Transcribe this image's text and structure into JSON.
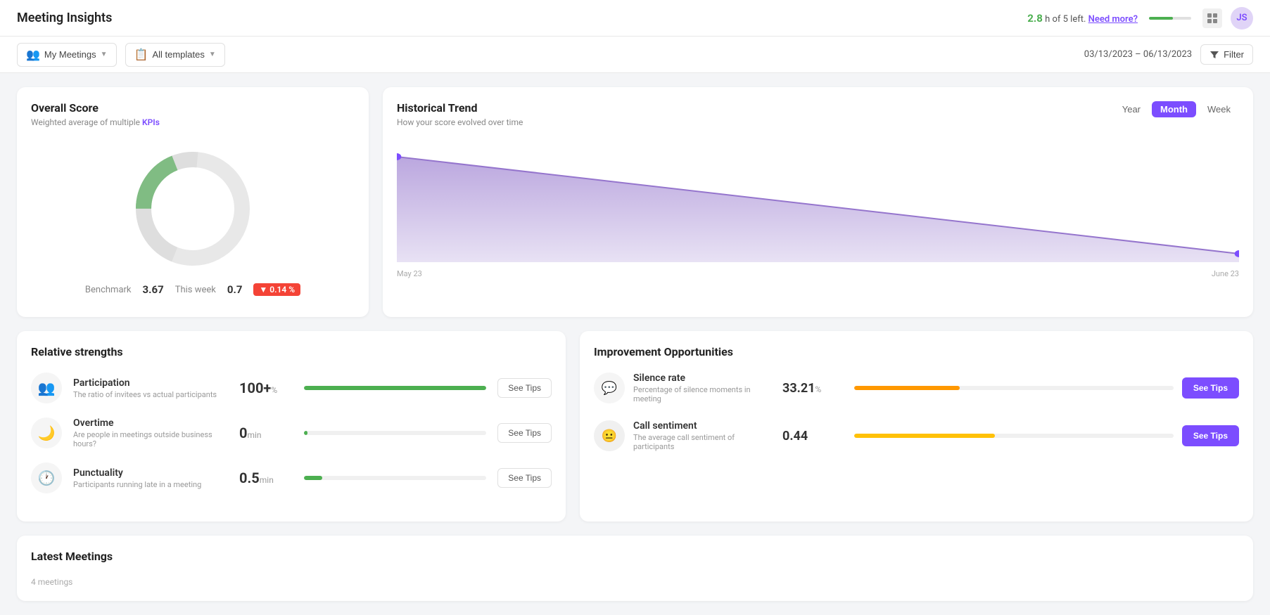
{
  "app": {
    "title": "Meeting Insights"
  },
  "topnav": {
    "hours_value": "2.8",
    "hours_label": "h of 5 left.",
    "need_more": "Need more?",
    "progress_pct": 56,
    "grid_icon": "⊞",
    "avatar_initials": "JS"
  },
  "filterbar": {
    "my_meetings_label": "My Meetings",
    "all_templates_label": "All templates",
    "date_range": "03/13/2023 – 06/13/2023",
    "filter_label": "Filter"
  },
  "overall_score": {
    "title": "Overall Score",
    "subtitle_start": "Weighted average of multiple ",
    "subtitle_kpi": "KPIs",
    "benchmark_label": "Benchmark",
    "benchmark_value": "3.67",
    "this_week_label": "This week",
    "this_week_value": "0.7",
    "change_badge": "▼ 0.14 %",
    "donut_filled_pct": 19,
    "donut_color_fill": "#4caf50",
    "donut_color_empty": "#e8e8e8"
  },
  "historical_trend": {
    "title": "Historical Trend",
    "subtitle": "How your score evolved over time",
    "period_buttons": [
      "Year",
      "Month",
      "Week"
    ],
    "active_period": "Month",
    "start_label": "May 23",
    "end_label": "June 23",
    "chart_color": "#b39ddb"
  },
  "relative_strengths": {
    "title": "Relative strengths",
    "metrics": [
      {
        "icon": "👥",
        "name": "Participation",
        "desc": "The ratio of invitees vs actual participants",
        "value": "100+",
        "unit": "%",
        "bar_pct": 100,
        "bar_color": "#4caf50"
      },
      {
        "icon": "🌙",
        "name": "Overtime",
        "desc": "Are people in meetings outside business hours?",
        "value": "0",
        "unit": "min",
        "bar_pct": 2,
        "bar_color": "#4caf50"
      },
      {
        "icon": "🕐",
        "name": "Punctuality",
        "desc": "Participants running late in a meeting",
        "value": "0.5",
        "unit": "min",
        "bar_pct": 10,
        "bar_color": "#4caf50"
      }
    ],
    "see_tips_label": "See Tips"
  },
  "improvement_opportunities": {
    "title": "Improvement Opportunities",
    "metrics": [
      {
        "icon": "💬",
        "name": "Silence rate",
        "desc": "Percentage of silence moments in meeting",
        "value": "33.21",
        "unit": "%",
        "bar_pct": 33,
        "bar_color": "#ff9800"
      },
      {
        "icon": "😐",
        "name": "Call sentiment",
        "desc": "The average call sentiment of participants",
        "value": "0.44",
        "unit": "",
        "bar_pct": 44,
        "bar_color": "#ffc107"
      }
    ],
    "see_tips_label": "See Tips"
  },
  "latest_meetings": {
    "title": "Latest Meetings",
    "subtitle": "4 meetings"
  }
}
